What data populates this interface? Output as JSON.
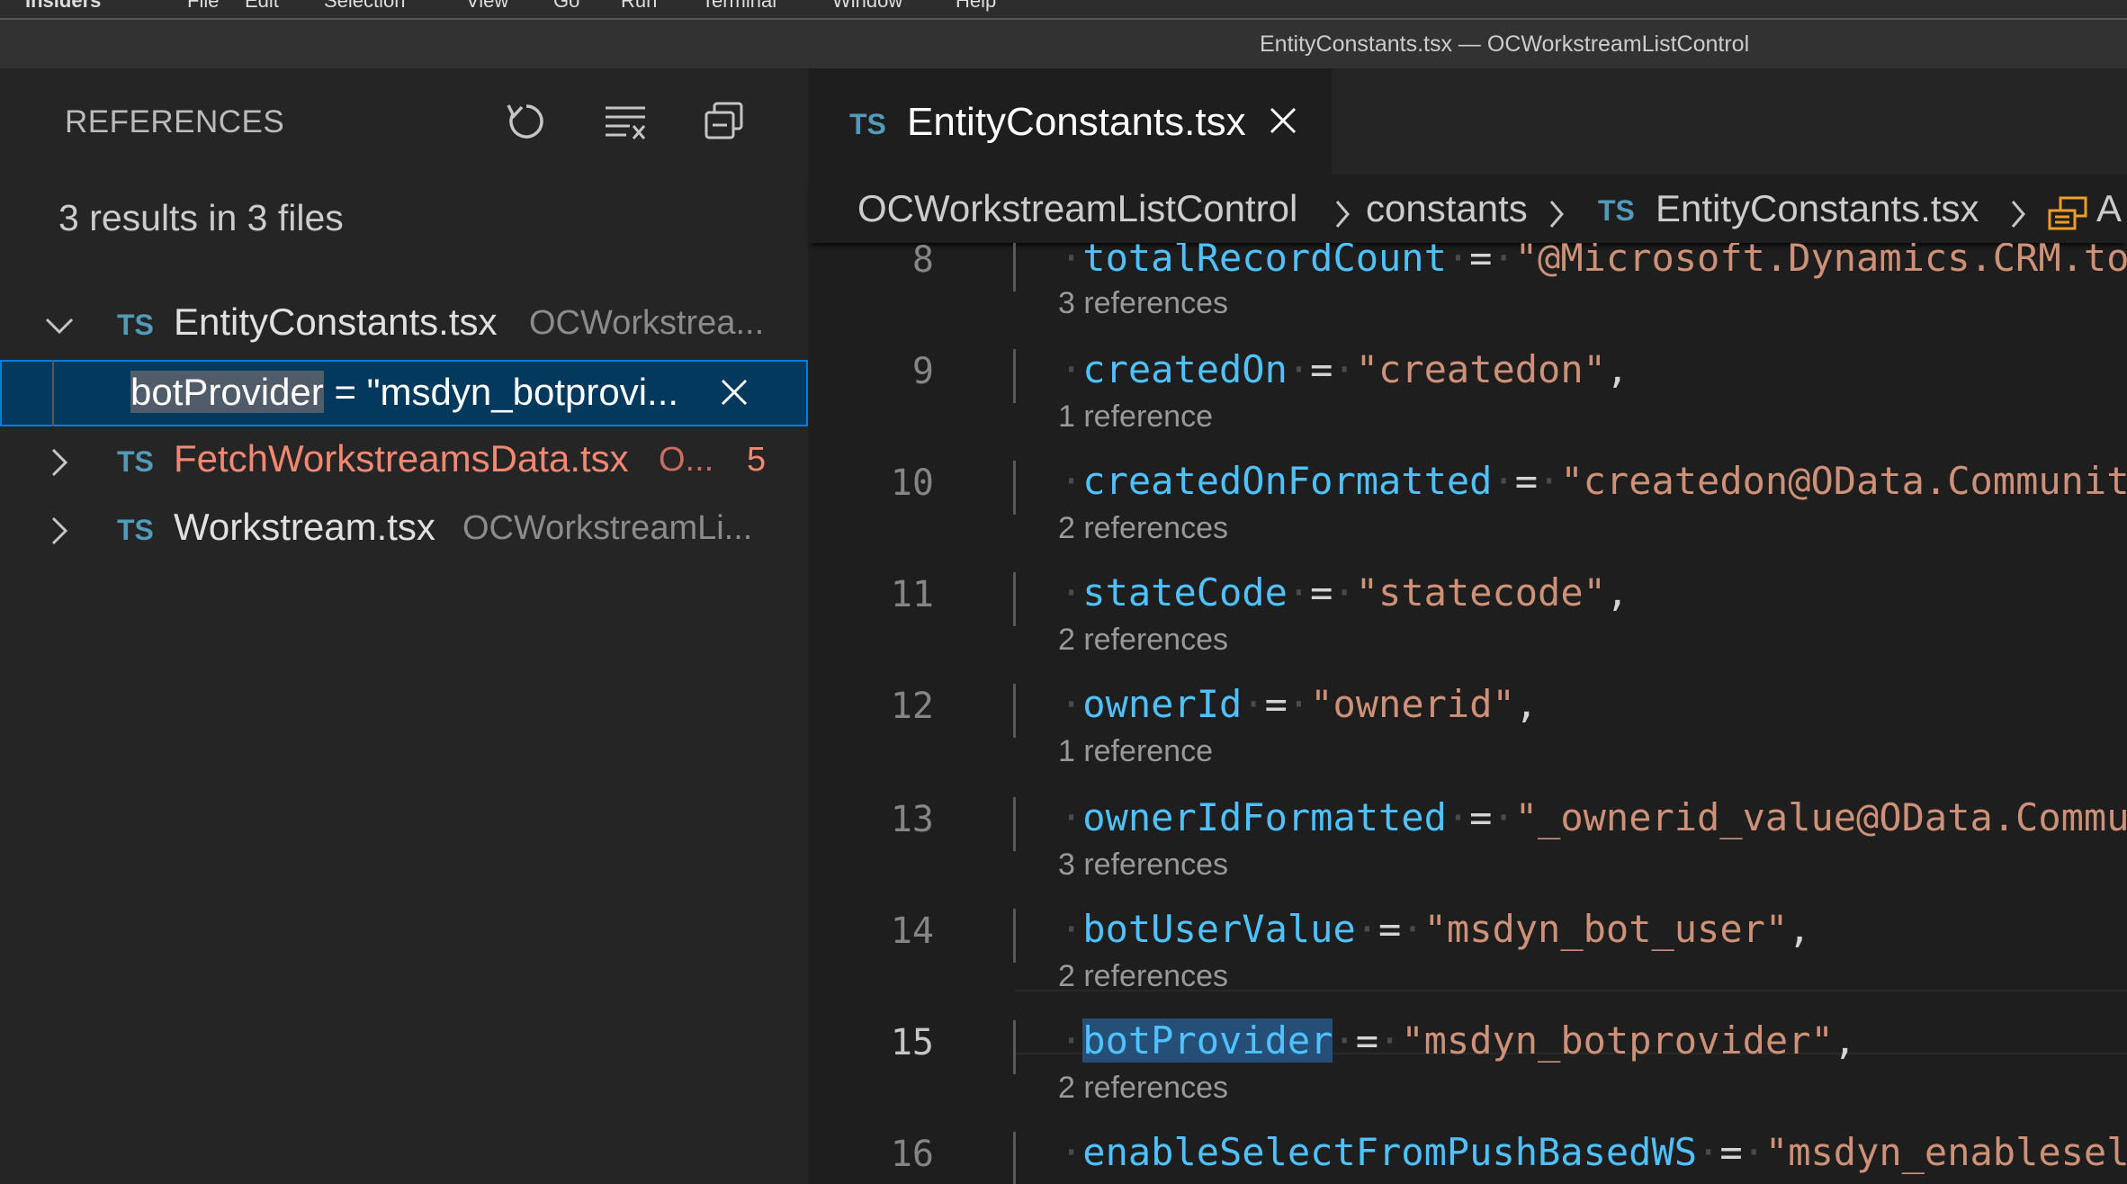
{
  "menubar": {
    "items": [
      "Insiders",
      "File",
      "Edit",
      "Selection",
      "View",
      "Go",
      "Run",
      "Terminal",
      "Window",
      "Help"
    ]
  },
  "window": {
    "title": "EntityConstants.tsx — OCWorkstreamListControl"
  },
  "references_panel": {
    "title": "REFERENCES",
    "icons": [
      "refresh-icon",
      "clear-all-icon",
      "collapse-all-icon"
    ],
    "summary": "3 results in 3 files",
    "files": [
      {
        "lang": "TS",
        "name": "EntityConstants.tsx",
        "path": "OCWorkstrea...",
        "expanded": true
      },
      {
        "lang": "TS",
        "name": "FetchWorkstreamsData.tsx",
        "path": "O...",
        "badge": "5",
        "expanded": false
      },
      {
        "lang": "TS",
        "name": "Workstream.tsx",
        "path": "OCWorkstreamLi...",
        "expanded": false
      }
    ],
    "selected_ref": {
      "highlight": "botProvider",
      "rest": " = \"msdyn_botprovi..."
    }
  },
  "editor": {
    "tab": {
      "lang": "TS",
      "name": "EntityConstants.tsx"
    },
    "breadcrumb": {
      "parts": [
        "OCWorkstreamListControl",
        "constants",
        "EntityConstants.tsx",
        "A"
      ],
      "lang": "TS"
    },
    "lines": [
      {
        "num": "8",
        "prop": "totalRecordCount",
        "value": "\"@Microsoft.Dynamics.CRM.tota",
        "trail": "",
        "lens": "3 references"
      },
      {
        "num": "9",
        "prop": "createdOn",
        "value": "\"createdon\"",
        "trail": ",",
        "lens": "1 reference"
      },
      {
        "num": "10",
        "prop": "createdOnFormatted",
        "value": "\"createdon@OData.Community.",
        "trail": "",
        "lens": "2 references"
      },
      {
        "num": "11",
        "prop": "stateCode",
        "value": "\"statecode\"",
        "trail": ",",
        "lens": "2 references"
      },
      {
        "num": "12",
        "prop": "ownerId",
        "value": "\"ownerid\"",
        "trail": ",",
        "lens": "1 reference"
      },
      {
        "num": "13",
        "prop": "ownerIdFormatted",
        "value": "\"_ownerid_value@OData.Communi",
        "trail": "",
        "lens": "3 references"
      },
      {
        "num": "14",
        "prop": "botUserValue",
        "value": "\"msdyn_bot_user\"",
        "trail": ",",
        "lens": "2 references"
      },
      {
        "num": "15",
        "prop": "botProvider",
        "value": "\"msdyn_botprovider\"",
        "trail": ",",
        "lens": "2 references"
      },
      {
        "num": "16",
        "prop": "enableSelectFromPushBasedWS",
        "value": "\"msdyn_enableselec",
        "trail": "",
        "lens": ""
      }
    ]
  }
}
